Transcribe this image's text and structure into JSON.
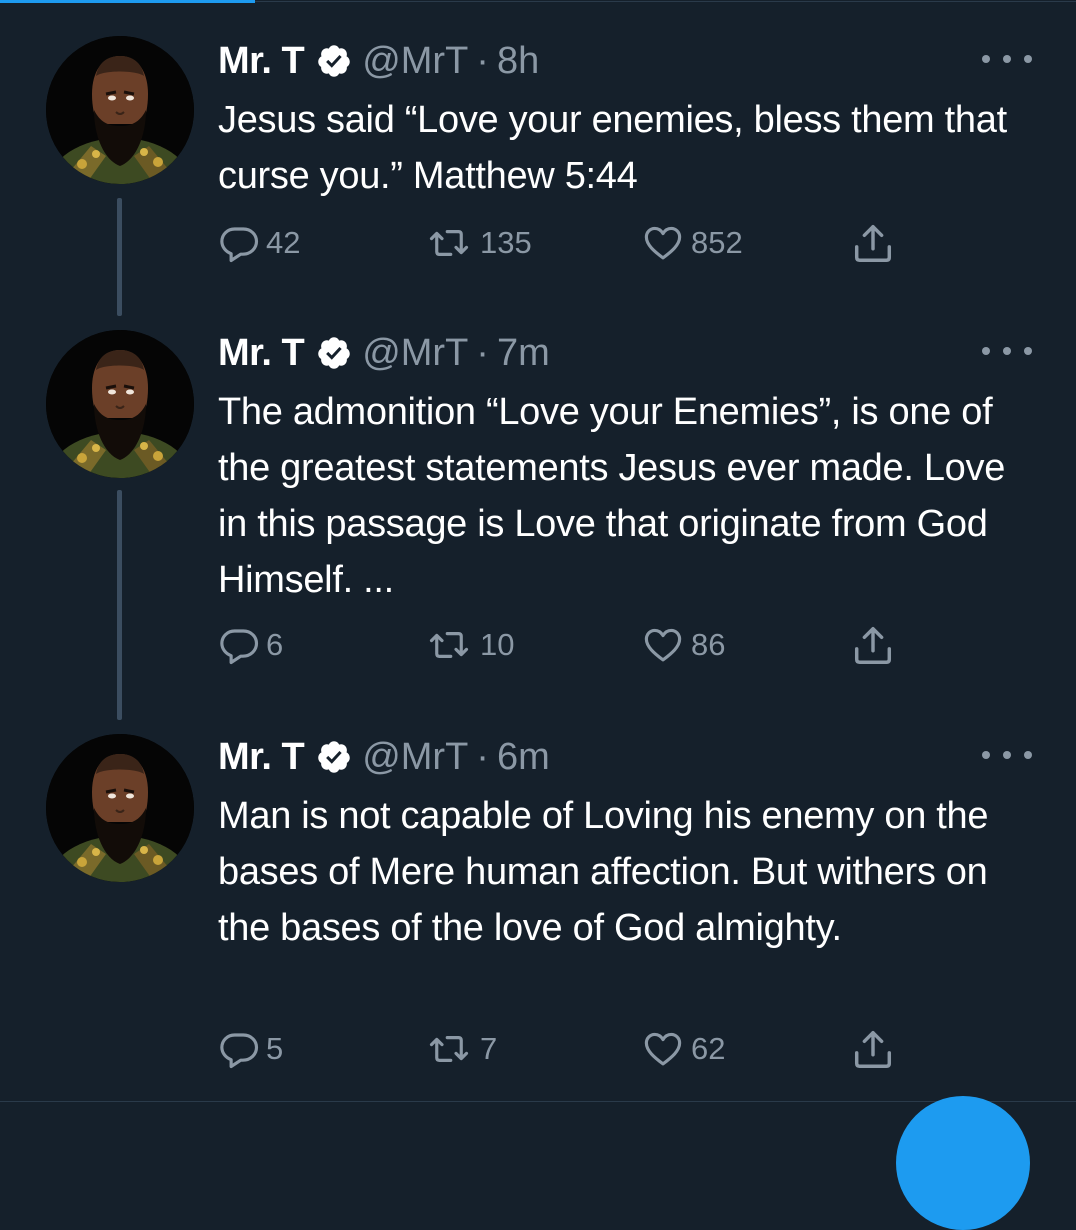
{
  "colors": {
    "background": "#15202b",
    "text_primary": "#ffffff",
    "text_secondary": "#8b98a5",
    "accent": "#1d9bf0",
    "thread_line": "#3b4d60"
  },
  "icons": {
    "verified": "verified-badge-icon",
    "more": "more-horizontal-icon",
    "reply": "reply-icon",
    "retweet": "retweet-icon",
    "like": "heart-icon",
    "share": "share-icon"
  },
  "tweets": [
    {
      "display_name": "Mr. T",
      "handle": "@MrT",
      "separator": "·",
      "timestamp": "8h",
      "text": "Jesus said “Love your enemies, bless them that curse you.” Matthew 5:44",
      "replies": "42",
      "retweets": "135",
      "likes": "852"
    },
    {
      "display_name": "Mr. T",
      "handle": "@MrT",
      "separator": "·",
      "timestamp": "7m",
      "text": "The admonition “Love your Enemies”, is one of the greatest statements Jesus ever made. Love in this passage is Love that originate from God Himself. ...",
      "replies": "6",
      "retweets": "10",
      "likes": "86"
    },
    {
      "display_name": "Mr. T",
      "handle": "@MrT",
      "separator": "·",
      "timestamp": "6m",
      "text": "Man is not capable of Loving his enemy on the bases of Mere human affection. But withers on the bases of the love of God almighty.",
      "replies": "5",
      "retweets": "7",
      "likes": "62"
    }
  ]
}
